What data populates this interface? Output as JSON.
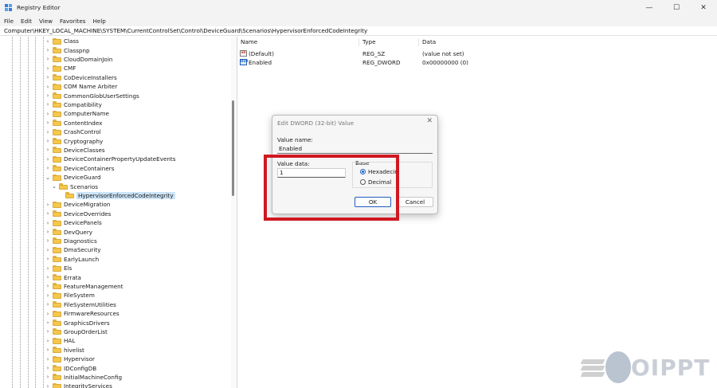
{
  "window": {
    "title": "Registry Editor",
    "minimize_glyph": "—",
    "maximize_glyph": "☐",
    "close_glyph": "✕"
  },
  "menu": [
    "File",
    "Edit",
    "View",
    "Favorites",
    "Help"
  ],
  "address": "Computer\\HKEY_LOCAL_MACHINE\\SYSTEM\\CurrentControlSet\\Control\\DeviceGuard\\Scenarios\\HypervisorEnforcedCodeIntegrity",
  "tree": {
    "items": [
      {
        "label": "Class",
        "chevron": "›"
      },
      {
        "label": "Classpnp",
        "chevron": "›"
      },
      {
        "label": "CloudDomainJoin",
        "chevron": "›"
      },
      {
        "label": "CMF",
        "chevron": "›"
      },
      {
        "label": "CoDeviceInstallers",
        "chevron": "›"
      },
      {
        "label": "COM Name Arbiter",
        "chevron": "›"
      },
      {
        "label": "CommonGlobUserSettings",
        "chevron": "›"
      },
      {
        "label": "Compatibility",
        "chevron": "›"
      },
      {
        "label": "ComputerName",
        "chevron": "›"
      },
      {
        "label": "ContentIndex",
        "chevron": "›"
      },
      {
        "label": "CrashControl",
        "chevron": "›"
      },
      {
        "label": "Cryptography",
        "chevron": "›"
      },
      {
        "label": "DeviceClasses",
        "chevron": "›"
      },
      {
        "label": "DeviceContainerPropertyUpdateEvents",
        "chevron": "›"
      },
      {
        "label": "DeviceContainers",
        "chevron": "›"
      },
      {
        "label": "DeviceGuard",
        "chevron": "⌄"
      },
      {
        "label": "Scenarios",
        "chevron": "⌄"
      },
      {
        "label": "HypervisorEnforcedCodeIntegrity",
        "chevron": ""
      },
      {
        "label": "DeviceMigration",
        "chevron": "›"
      },
      {
        "label": "DeviceOverrides",
        "chevron": "›"
      },
      {
        "label": "DevicePanels",
        "chevron": "›"
      },
      {
        "label": "DevQuery",
        "chevron": "›"
      },
      {
        "label": "Diagnostics",
        "chevron": "›"
      },
      {
        "label": "DmaSecurity",
        "chevron": "›"
      },
      {
        "label": "EarlyLaunch",
        "chevron": "›"
      },
      {
        "label": "Els",
        "chevron": "›"
      },
      {
        "label": "Errata",
        "chevron": "›"
      },
      {
        "label": "FeatureManagement",
        "chevron": "›"
      },
      {
        "label": "FileSystem",
        "chevron": "›"
      },
      {
        "label": "FileSystemUtilities",
        "chevron": "›"
      },
      {
        "label": "FirmwareResources",
        "chevron": "›"
      },
      {
        "label": "GraphicsDrivers",
        "chevron": "›"
      },
      {
        "label": "GroupOrderList",
        "chevron": "›"
      },
      {
        "label": "HAL",
        "chevron": "›"
      },
      {
        "label": "hivelist",
        "chevron": "›"
      },
      {
        "label": "Hypervisor",
        "chevron": "›"
      },
      {
        "label": "IDConfigDB",
        "chevron": "›"
      },
      {
        "label": "InitialMachineConfig",
        "chevron": "›"
      },
      {
        "label": "IntegrityServices",
        "chevron": "›"
      }
    ]
  },
  "values_pane": {
    "columns": [
      "Name",
      "Type",
      "Data"
    ],
    "rows": [
      {
        "icon": "ab",
        "name": "(Default)",
        "type": "REG_SZ",
        "data": "(value not set)"
      },
      {
        "icon": "010",
        "name": "Enabled",
        "type": "REG_DWORD",
        "data": "0x00000000 (0)"
      }
    ]
  },
  "dialog": {
    "title": "Edit DWORD (32-bit) Value",
    "value_name_label": "Value name:",
    "value_name": "Enabled",
    "value_data_label": "Value data:",
    "value_data": "1",
    "base_label": "Base",
    "hex_label": "Hexadecimal",
    "dec_label": "Decimal",
    "ok_label": "OK",
    "cancel_label": "Cancel",
    "close_glyph": "✕"
  },
  "watermark": {
    "text": "OIPPT"
  }
}
